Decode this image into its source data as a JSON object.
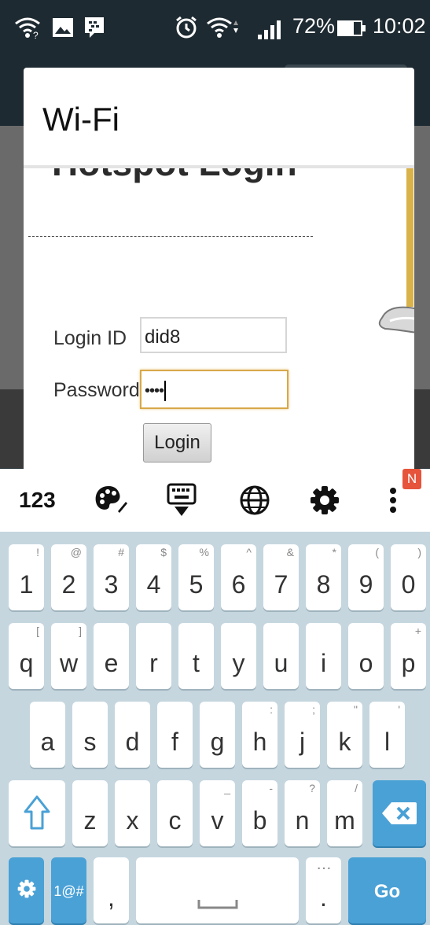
{
  "status_bar": {
    "battery_percent": "72%",
    "time": "10:02",
    "icons": [
      "wifi-question-icon",
      "gallery-icon",
      "bbm-icon",
      "alarm-icon",
      "wifi-icon",
      "signal-icon",
      "battery-icon"
    ]
  },
  "dialog": {
    "title": "Wi-Fi",
    "page_heading": "Hotspot Login",
    "login_id_label": "Login ID",
    "login_id_value": "did8",
    "password_label": "Password",
    "password_value": "••••",
    "login_button": "Login"
  },
  "keyboard_toolbar": {
    "numbers_label": "123",
    "badge": "N",
    "icons": [
      "theme-palette-icon",
      "hide-keyboard-icon",
      "language-globe-icon",
      "settings-gear-icon",
      "more-options-icon"
    ]
  },
  "keyboard": {
    "rows": [
      [
        {
          "k": "1",
          "h": "!"
        },
        {
          "k": "2",
          "h": "@"
        },
        {
          "k": "3",
          "h": "#"
        },
        {
          "k": "4",
          "h": "$"
        },
        {
          "k": "5",
          "h": "%"
        },
        {
          "k": "6",
          "h": "^"
        },
        {
          "k": "7",
          "h": "&"
        },
        {
          "k": "8",
          "h": "*"
        },
        {
          "k": "9",
          "h": "("
        },
        {
          "k": "0",
          "h": ")"
        }
      ],
      [
        {
          "k": "q",
          "h": "["
        },
        {
          "k": "w",
          "h": "]"
        },
        {
          "k": "e",
          "h": ""
        },
        {
          "k": "r",
          "h": ""
        },
        {
          "k": "t",
          "h": ""
        },
        {
          "k": "y",
          "h": ""
        },
        {
          "k": "u",
          "h": ""
        },
        {
          "k": "i",
          "h": ""
        },
        {
          "k": "o",
          "h": ""
        },
        {
          "k": "p",
          "h": "+"
        }
      ],
      [
        {
          "k": "a",
          "h": ""
        },
        {
          "k": "s",
          "h": ""
        },
        {
          "k": "d",
          "h": ""
        },
        {
          "k": "f",
          "h": ""
        },
        {
          "k": "g",
          "h": ""
        },
        {
          "k": "h",
          "h": ":"
        },
        {
          "k": "j",
          "h": ";"
        },
        {
          "k": "k",
          "h": "\""
        },
        {
          "k": "l",
          "h": "'"
        }
      ],
      [
        {
          "k": "z",
          "h": ""
        },
        {
          "k": "x",
          "h": ""
        },
        {
          "k": "c",
          "h": ""
        },
        {
          "k": "v",
          "h": "_"
        },
        {
          "k": "b",
          "h": "-"
        },
        {
          "k": "n",
          "h": "?"
        },
        {
          "k": "m",
          "h": "/"
        }
      ]
    ],
    "symbols_label": "1@#",
    "comma": ",",
    "period": ".",
    "period_hint": "…",
    "go_label": "Go",
    "colors": {
      "accent": "#4aa1d6",
      "background": "#c5d6df"
    }
  }
}
